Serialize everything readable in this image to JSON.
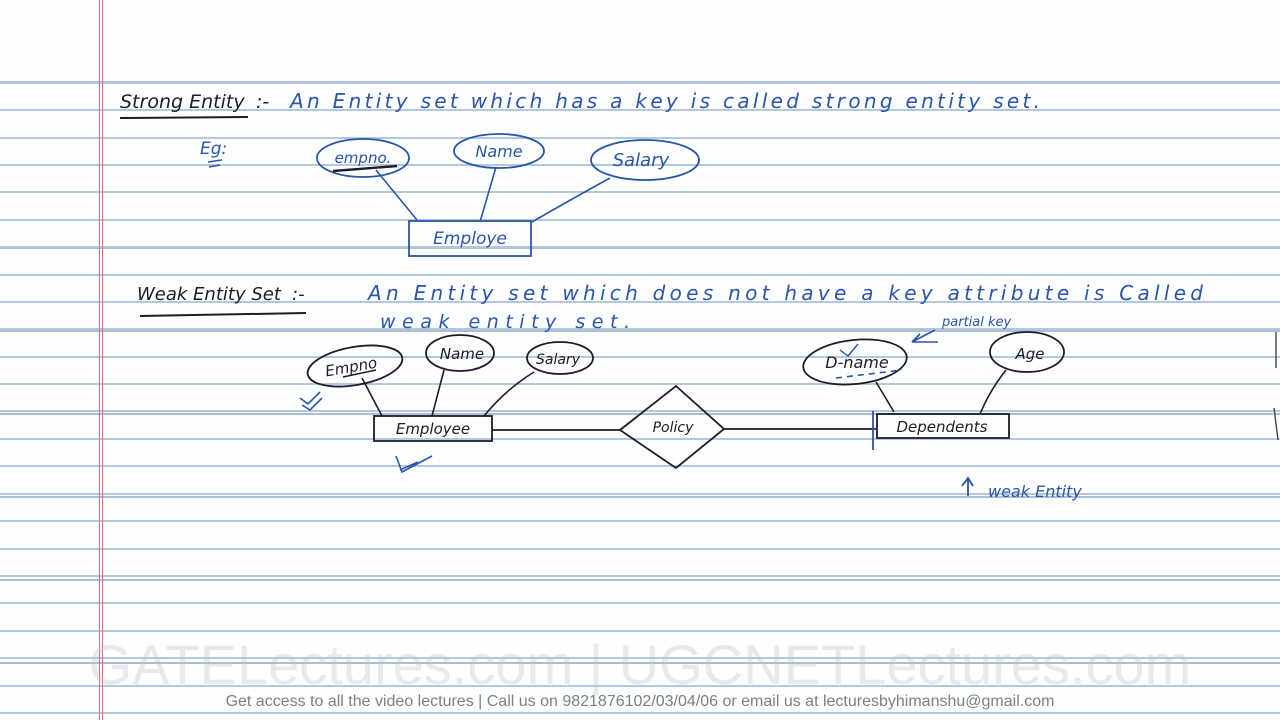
{
  "notebook": {
    "strong_entity": {
      "heading": "Strong Entity",
      "definition_sep": ":-",
      "definition": "An Entity set which has a key is called strong entity set.",
      "example_label": "Eg:",
      "diagram": {
        "entity": "Employe",
        "attributes": [
          {
            "label": "empno.",
            "is_key": true
          },
          {
            "label": "Name",
            "is_key": false
          },
          {
            "label": "Salary",
            "is_key": false
          }
        ]
      }
    },
    "weak_entity": {
      "heading": "Weak Entity Set",
      "definition_sep": ":-",
      "definition_line1": "An Entity set which does not have a key attribute is Called",
      "definition_line2": "weak entity set.",
      "diagram": {
        "strong_entity": "Employee",
        "strong_attributes": [
          {
            "label": "Empno",
            "is_key": true
          },
          {
            "label": "Name",
            "is_key": false
          },
          {
            "label": "Salary",
            "is_key": false
          }
        ],
        "relationship": "Policy",
        "weak_entity": "Dependents",
        "weak_attributes": [
          {
            "label": "D-name",
            "is_partial_key": true
          },
          {
            "label": "Age",
            "is_partial_key": false
          }
        ],
        "partial_key_note": "partial key",
        "weak_entity_note": "weak Entity"
      }
    }
  },
  "branding": {
    "watermark": "GATELectures.com | UGCNETLectures.com",
    "footer": "Get access to all the video lectures | Call us on 9821876102/03/04/06 or email us at lecturesbyhimanshu@gmail.com"
  },
  "colors": {
    "blue_ink": "#2a55a8",
    "black_ink": "#1c1c2a",
    "rule_line": "#b3c8dc",
    "margin_line": "#e06a7c"
  }
}
